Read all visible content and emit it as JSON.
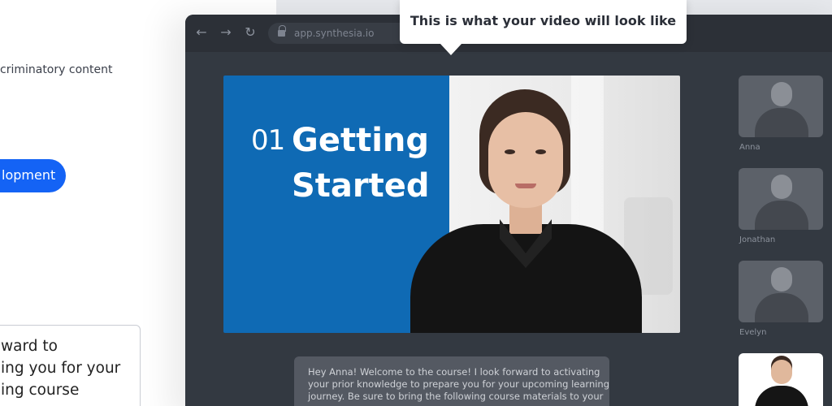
{
  "left_panel": {
    "top_text": "criminatory content",
    "pill_label": "lopment",
    "card_lines": [
      "ward to",
      "ing you for your",
      "ing course"
    ]
  },
  "browser": {
    "address": "app.synthesia.io",
    "nav": {
      "back": "←",
      "forward": "→",
      "reload": "↻"
    }
  },
  "tooltip": {
    "text": "This is what your video will look like"
  },
  "slide": {
    "number": "01",
    "title_line1": "Getting",
    "title_line2": "Started",
    "colors": {
      "panel": "#0f6ab4"
    }
  },
  "avatars": [
    {
      "name": "Anna"
    },
    {
      "name": "Jonathan"
    },
    {
      "name": "Evelyn"
    },
    {
      "name": "",
      "selected": true
    }
  ],
  "script": {
    "lines": [
      "Hey Anna! Welcome to the course! I look forward to activating",
      "your prior knowledge to prepare you for your upcoming learning",
      "journey. Be sure to bring the following course materials to your"
    ]
  },
  "colors": {
    "accent": "#1463f5",
    "window": "#333941"
  }
}
